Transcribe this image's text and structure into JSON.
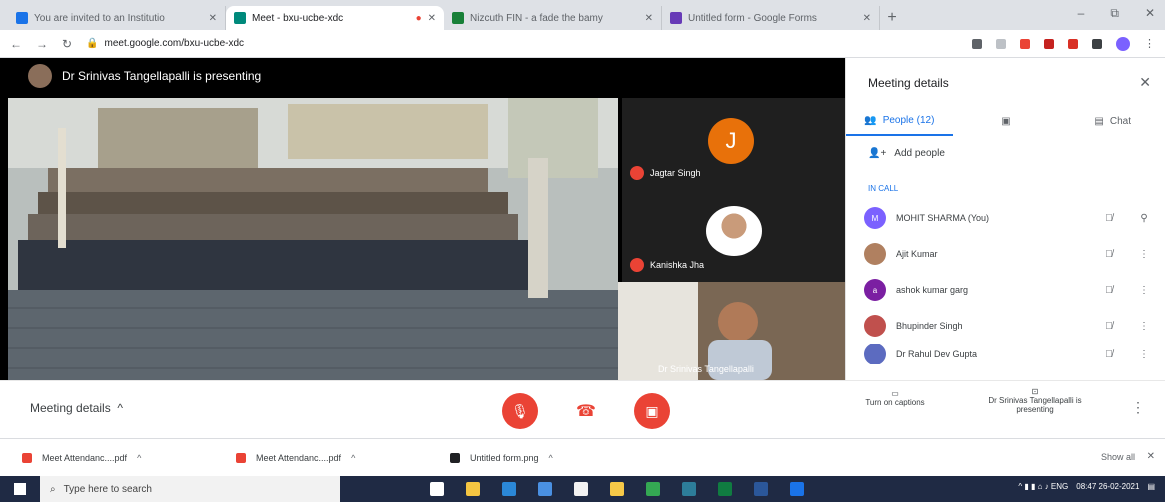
{
  "browser": {
    "tabs": [
      {
        "label": "You are invited to an Institutio",
        "active": false,
        "color": "#1a73e8"
      },
      {
        "label": "Meet - bxu-ucbe-xdc",
        "active": true,
        "color": "#00897b"
      },
      {
        "label": "Nizcuth FIN - a fade the bamy",
        "active": false,
        "color": "#188038"
      },
      {
        "label": "Untitled form - Google Forms",
        "active": false,
        "color": "#673ab7"
      }
    ],
    "url": "meet.google.com/bxu-ucbe-xdc",
    "window_controls": [
      "–",
      "⧉",
      "✕"
    ]
  },
  "meet": {
    "presenting_banner": "Dr Srinivas Tangellapalli is presenting",
    "tiles": [
      {
        "initial": "J",
        "name": "Jagtar Singh"
      },
      {
        "name": "Kanishka Jha"
      }
    ],
    "self_name": "Dr Srinivas Tangellapalli"
  },
  "panel": {
    "title": "Meeting details",
    "tabs": [
      {
        "label": "People (12)",
        "active": true
      },
      {
        "label": "",
        "active": false
      },
      {
        "label": "Chat",
        "active": false
      }
    ],
    "add_people": "Add people",
    "section_label": "IN CALL",
    "participants": [
      {
        "initials": "M",
        "name": "MOHIT SHARMA (You)",
        "color": "#7b61ff"
      },
      {
        "initials": "",
        "name": "Ajit Kumar",
        "color": "#b08060"
      },
      {
        "initials": "a",
        "name": "ashok kumar garg",
        "color": "#7b1fa2"
      },
      {
        "initials": "",
        "name": "Bhupinder Singh",
        "color": "#c0504d"
      },
      {
        "initials": "",
        "name": "Dr Rahul Dev Gupta",
        "color": "#5c6bc0"
      }
    ]
  },
  "controls": {
    "meeting_details": "Meeting details",
    "captions": "Turn on captions",
    "presenting": "Dr Srinivas Tangellapalli is presenting"
  },
  "downloads": {
    "items": [
      {
        "label": "Meet Attendanc....pdf"
      },
      {
        "label": "Meet Attendanc....pdf"
      },
      {
        "label": "Untitled form.png"
      }
    ],
    "show_all": "Show all"
  },
  "taskbar": {
    "search_placeholder": "Type here to search",
    "time": "08:47",
    "date": "26-02-2021"
  }
}
